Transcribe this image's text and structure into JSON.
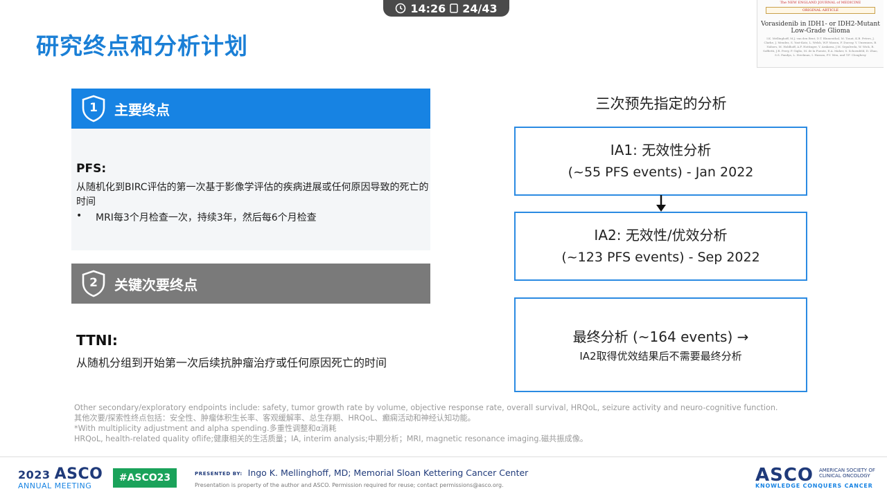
{
  "status_bar": {
    "time": "14:26",
    "page": "24/43"
  },
  "title": "研究终点和分析计划",
  "thumbnail": {
    "journal": "The NEW ENGLAND JOURNAL of MEDICINE",
    "tag": "ORIGINAL ARTICLE",
    "article_title_line1": "Vorasidenib in IDH1- or IDH2-Mutant",
    "article_title_line2": "Low-Grade Glioma",
    "authors": "I.K. Mellinghoff, M.J. van den Bent, D.T. Blumenthal, M. Touat, K.B. Peters, J. Clarke, J. Mendez, S. Yust-Katz, L. Welsh, W.P. Mason, F. Ducray, Y. Umemura, B. Nabors, M. Holdhoff, A.F. Hottinger, Y. Arakawa, J.M. Sepulveda, W. Wick, R. Soffietti, J.R. Perry, P. Giglio, M. de la Fuente, E.A. Maher, S. Schoenfeld, D. Zhao, S.S. Pandya, L. Steelman, I. Hassan, P.Y. Wen, and T.F. Cloughesy"
  },
  "primary": {
    "number": "1",
    "header": "主要终点",
    "label": "PFS:",
    "description": "从随机化到BIRC评估的第一次基于影像学评估的疾病进展或任何原因导致的死亡的时间",
    "bullet_marker": "•",
    "bullet": "MRI每3个月检查一次，持续3年，然后每6个月检查"
  },
  "secondary": {
    "number": "2",
    "header": "关键次要终点",
    "label": "TTNI:",
    "description": "从随机分组到开始第一次后续抗肿瘤治疗或任何原因死亡的时间"
  },
  "flow": {
    "title": "三次预先指定的分析",
    "box1": {
      "line1": "IA1: 无效性分析",
      "line2": "(~55 PFS events) - Jan 2022"
    },
    "box2": {
      "line1": "IA2: 无效性/优效分析",
      "line2": "(~123 PFS events) - Sep 2022"
    },
    "box3": {
      "line1": "最终分析 (~164 events) →",
      "line2": "IA2取得优效结果后不需要最终分析"
    }
  },
  "footnotes": [
    "Other secondary/exploratory endpoints include: safety, tumor growth rate by volume, objective response rate, overall survival, HRQoL, seizure activity and neuro-cognitive function.",
    "其他次要/探索性终点包括：安全性、肿瘤体积生长率、客观缓解率、总生存期、HRQoL、癫痫活动和神经认知功能。",
    "*With multiplicity adjustment and alpha spending.多重性调整和α消耗",
    "HRQoL, health-related quality oflife;健康相关的生活质量；IA, interim analysis;中期分析；MRI, magnetic resonance imaging.磁共振成像。"
  ],
  "footer": {
    "year": "2023",
    "asco": "ASCO",
    "annual_meeting": "ANNUAL MEETING",
    "hashtag": "#ASCO23",
    "presented_by": "PRESENTED BY:",
    "presenter": "Ingo K. Mellinghoff, MD; Memorial Sloan Kettering Cancer Center",
    "notice": "Presentation is property of the author and ASCO. Permission required for reuse; contact permissions@asco.org.",
    "asco_logo": "ASCO",
    "society": "AMERICAN SOCIETY OF CLINICAL ONCOLOGY",
    "tagline": "KNOWLEDGE CONQUERS CANCER"
  },
  "colors": {
    "title_blue": "#1a7fd6",
    "primary_header": "#1783e3",
    "secondary_header": "#7a7a7a",
    "box_border": "#2a8ae2",
    "hashtag_green": "#1aa25a",
    "asco_navy": "#1f3a7a"
  }
}
